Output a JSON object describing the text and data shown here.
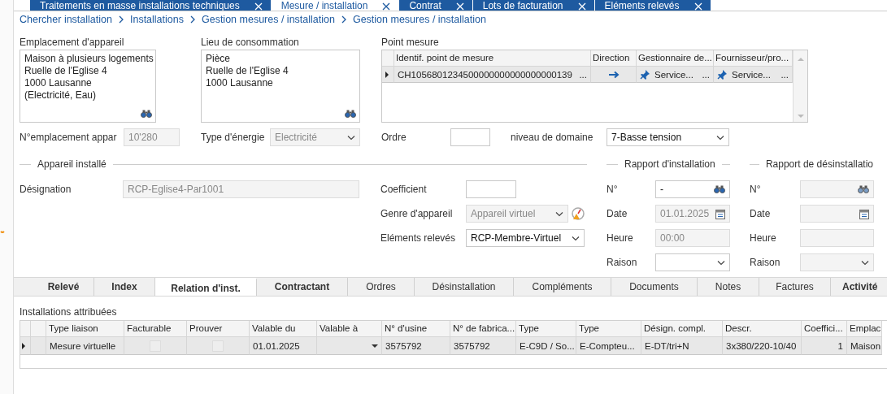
{
  "document_tabs": [
    {
      "label": "Traitements en masse installations techniques",
      "selected": false
    },
    {
      "label": "Mesure / installation",
      "selected": true
    },
    {
      "label": "Contrat",
      "selected": false
    },
    {
      "label": "Lots de facturation",
      "selected": false
    },
    {
      "label": "Eléments relevés",
      "selected": false
    }
  ],
  "breadcrumb": [
    "Chercher installation",
    "Installations",
    "Gestion mesures / installation",
    "Gestion mesures / installation"
  ],
  "emplacement": {
    "label": "Emplacement d'appareil",
    "lines": [
      "Maison à plusieurs logements",
      "Ruelle de l'Eglise 4",
      "1000 Lausanne",
      "(Electricité, Eau)"
    ]
  },
  "lieu": {
    "label": "Lieu de consommation",
    "lines": [
      "Pièce",
      "Ruelle de l'Eglise 4",
      "1000 Lausanne"
    ]
  },
  "point_mesure": {
    "label": "Point mesure",
    "columns": [
      "Identif. point de mesure",
      "Direction",
      "Gestionnaire de...",
      "Fournisseur/pro..."
    ],
    "rows": [
      {
        "selected": true,
        "cells": [
          {
            "kind": "text",
            "text": "CH1056801234500000000000000000139",
            "button": "..."
          },
          {
            "kind": "arrow"
          },
          {
            "kind": "pin",
            "text": "Service...",
            "button": "..."
          },
          {
            "kind": "pin",
            "text": "Service...",
            "button": "..."
          }
        ]
      }
    ]
  },
  "emplacement_no": {
    "label": "N°emplacement appar",
    "kind": "text",
    "value": "10'280",
    "disabled": true
  },
  "type_energie": {
    "label": "Type d'énergie",
    "kind": "select",
    "value": "Electricité",
    "disabled": true
  },
  "ordre": {
    "label": "Ordre",
    "kind": "text",
    "disabled": false
  },
  "niveau_domaine": {
    "label": "niveau de domaine",
    "kind": "select",
    "value": "7-Basse tension",
    "disabled": false
  },
  "appareil_installe": {
    "title": "Appareil installé",
    "designation": {
      "label": "Désignation",
      "kind": "text",
      "value": "RCP-Eglise4-Par1001",
      "disabled": true
    },
    "fields": [
      {
        "label": "Coefficient",
        "kind": "text",
        "disabled": false,
        "alert": false
      },
      {
        "label": "Genre d'appareil",
        "kind": "select",
        "value": "Appareil virtuel",
        "disabled": true,
        "alert": true
      },
      {
        "label": "Eléments relevés",
        "kind": "select",
        "value": "RCP-Membre-Virtuel",
        "disabled": false,
        "alert": false
      }
    ]
  },
  "rapport_installation": {
    "title": "Rapport d'installation",
    "fields": [
      {
        "label": "N°",
        "kind": "lookup",
        "value": "-",
        "disabled": false
      },
      {
        "label": "Date",
        "kind": "date",
        "value": "01.01.2025",
        "disabled": true
      },
      {
        "label": "Heure",
        "kind": "text",
        "value": "00:00",
        "disabled": true
      },
      {
        "label": "Raison",
        "kind": "select",
        "disabled": false
      }
    ]
  },
  "rapport_desinstallation": {
    "title": "Rapport de désinstallatio",
    "fields": [
      {
        "label": "N°",
        "kind": "lookup",
        "disabled": true
      },
      {
        "label": "Date",
        "kind": "date",
        "disabled": true
      },
      {
        "label": "Heure",
        "kind": "text",
        "disabled": true
      },
      {
        "label": "Raison",
        "kind": "select",
        "disabled": true
      }
    ]
  },
  "detail_tabs": [
    {
      "label": "Relevé",
      "selected": false,
      "has_data": true
    },
    {
      "label": "Index",
      "selected": false,
      "has_data": true
    },
    {
      "label": "Relation d'inst.",
      "selected": true,
      "has_data": true
    },
    {
      "label": "Contractant",
      "selected": false,
      "has_data": true
    },
    {
      "label": "Ordres",
      "selected": false,
      "has_data": false
    },
    {
      "label": "Désinstallation",
      "selected": false,
      "has_data": false
    },
    {
      "label": "Compléments",
      "selected": false,
      "has_data": false
    },
    {
      "label": "Documents",
      "selected": false,
      "has_data": false
    },
    {
      "label": "Notes",
      "selected": false,
      "has_data": false
    },
    {
      "label": "Factures",
      "selected": false,
      "has_data": false
    },
    {
      "label": "Activité",
      "selected": false,
      "has_data": true
    }
  ],
  "installations": {
    "label": "Installations attribuées",
    "columns": [
      "Type liaison",
      "Facturable",
      "Prouver",
      "Valable du",
      "Valable à",
      "N° d'usine",
      "N° de fabrica...",
      "Type",
      "Type",
      "Désign. compl.",
      "Descr.",
      "Coeffici...",
      "Emplac"
    ],
    "rows": [
      {
        "selected": true,
        "cells": [
          {
            "kind": "text",
            "text": "Mesure virtuelle"
          },
          {
            "kind": "checkbox",
            "checked": false
          },
          {
            "kind": "checkbox",
            "checked": false
          },
          {
            "kind": "text",
            "text": "01.01.2025"
          },
          {
            "kind": "dropdown"
          },
          {
            "kind": "text",
            "text": "3575792"
          },
          {
            "kind": "text",
            "text": "3575792"
          },
          {
            "kind": "text",
            "text": "E-C9D / So..."
          },
          {
            "kind": "text",
            "text": "E-Compteu..."
          },
          {
            "kind": "text",
            "text": "E-DT/tri+N"
          },
          {
            "kind": "text",
            "text": "3x380/220-10/40"
          },
          {
            "kind": "number",
            "text": "1"
          },
          {
            "kind": "text",
            "text": "Maison"
          }
        ]
      }
    ]
  }
}
